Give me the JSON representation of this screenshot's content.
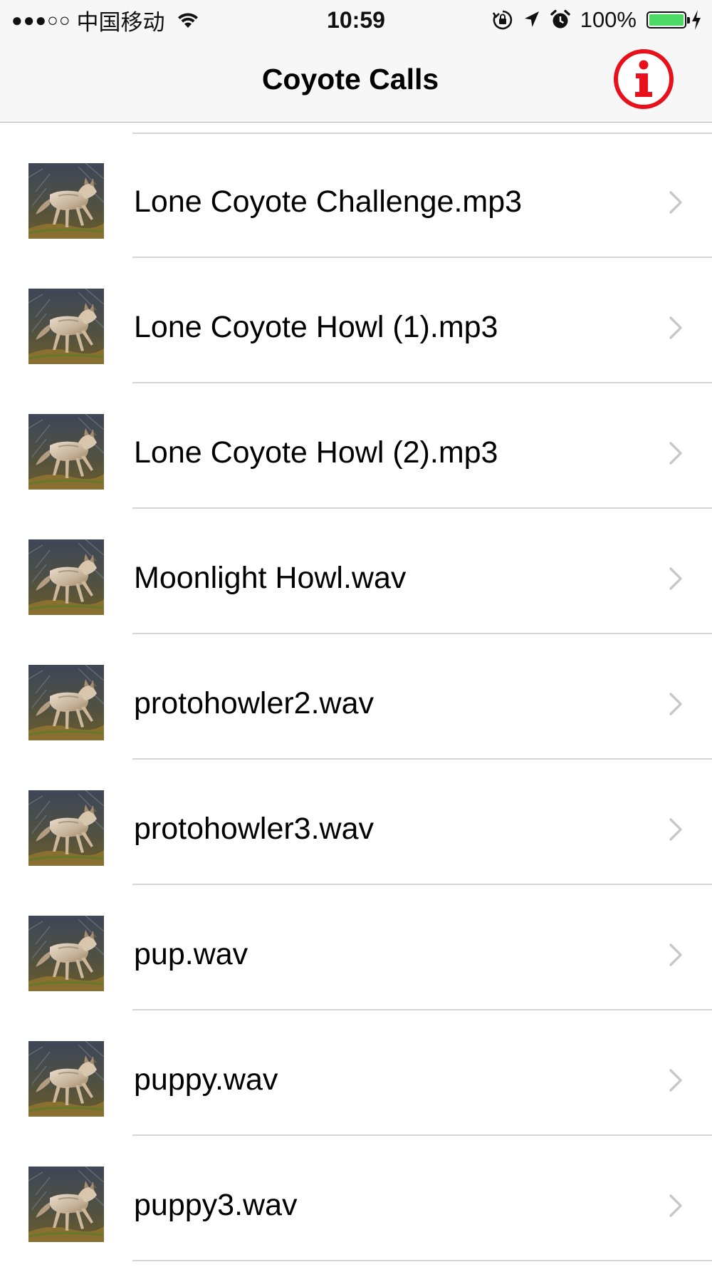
{
  "status_bar": {
    "signal": "●●●○○",
    "carrier": "中国移动",
    "time": "10:59",
    "battery_percent": "100%",
    "battery_level": 1.0,
    "battery_color": "#4cd964",
    "icons": [
      "wifi-icon",
      "orientation-lock-icon",
      "location-arrow-icon",
      "alarm-icon",
      "charging-bolt-icon"
    ]
  },
  "nav": {
    "title": "Coyote Calls",
    "info_icon": "info-circle-icon",
    "info_color": "#e8101a"
  },
  "list": {
    "thumbnail_icon": "coyote-thumbnail",
    "accessory_icon": "chevron-right-icon",
    "items": [
      {
        "label": "Lone Coyote Challenge.mp3"
      },
      {
        "label": "Lone Coyote Howl (1).mp3"
      },
      {
        "label": "Lone Coyote Howl (2).mp3"
      },
      {
        "label": "Moonlight Howl.wav"
      },
      {
        "label": "protohowler2.wav"
      },
      {
        "label": "protohowler3.wav"
      },
      {
        "label": "pup.wav"
      },
      {
        "label": "puppy.wav"
      },
      {
        "label": "puppy3.wav"
      }
    ]
  }
}
